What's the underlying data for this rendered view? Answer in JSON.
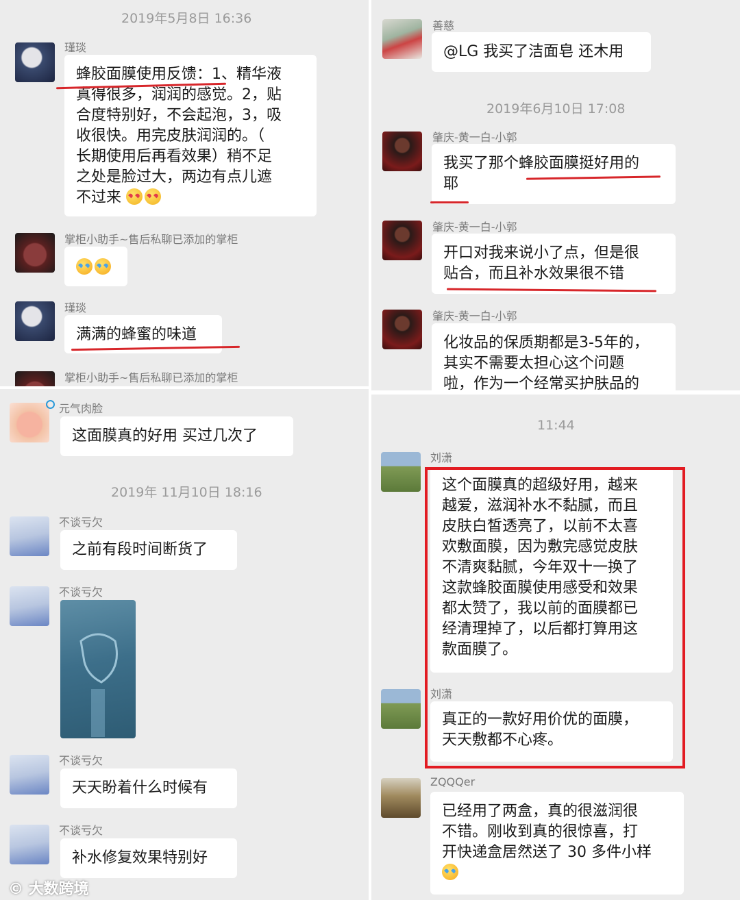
{
  "panel_top_left": {
    "timestamp": "2019年5月8日 16:36",
    "messages": [
      {
        "name": "瑾琰",
        "lines": [
          "蜂胶面膜使用反馈：1、精华液",
          "真得很多，润润的感觉。2，贴",
          "合度特别好，不会起泡，3，吸",
          "收很快。用完皮肤润润的。（",
          "长期使用后再看效果）稍不足",
          "之处是脸过大，两边有点儿遮",
          "不过来"
        ],
        "emoji": "heart-eyes-emoji"
      },
      {
        "name": "掌柜小助手~售后私聊已添加的掌柜",
        "emoji": "clapping-emoji"
      },
      {
        "name": "瑾琰",
        "lines": [
          "满满的蜂蜜的味道"
        ]
      },
      {
        "name": "掌柜小助手~售后私聊已添加的掌柜"
      }
    ]
  },
  "panel_top_right": {
    "messages": [
      {
        "name": "善慈",
        "lines": [
          "@LG 我买了洁面皂 还木用"
        ]
      },
      {
        "timestamp": "2019年6月10日 17:08"
      },
      {
        "name": "肇庆-黄一白-小郭",
        "lines": [
          "我买了那个蜂胶面膜挺好用的",
          "耶"
        ]
      },
      {
        "name": "肇庆-黄一白-小郭",
        "lines": [
          "开口对我来说小了点，但是很",
          "贴合，而且补水效果很不错"
        ]
      },
      {
        "name": "肇庆-黄一白-小郭",
        "lines": [
          "化妆品的保质期都是3-5年的，",
          "其实不需要太担心这个问题",
          "啦，作为一个经常买护肤品的"
        ]
      }
    ]
  },
  "panel_bottom_left": {
    "messages": [
      {
        "name": "元气肉脸",
        "lines": [
          "这面膜真的好用 买过几次了"
        ]
      },
      {
        "timestamp": "2019年 11月10日 18:16"
      },
      {
        "name": "不谈亏欠",
        "lines": [
          "之前有段时间断货了"
        ]
      },
      {
        "name": "不谈亏欠",
        "image": "product-photo"
      },
      {
        "name": "不谈亏欠",
        "lines": [
          "天天盼着什么时候有"
        ]
      },
      {
        "name": "不谈亏欠",
        "lines": [
          "补水修复效果特别好"
        ]
      }
    ]
  },
  "panel_bottom_right": {
    "timestamp": "11:44",
    "messages": [
      {
        "name": "刘潇",
        "lines": [
          "这个面膜真的超级好用，越来",
          "越爱，滋润补水不黏腻，而且",
          "皮肤白皙透亮了，以前不太喜",
          "欢敷面膜，因为敷完感觉皮肤",
          "不清爽黏腻，今年双十一换了",
          "这款蜂胶面膜使用感受和效果",
          "都太赞了，我以前的面膜都已",
          "经清理掉了，以后都打算用这",
          "款面膜了。"
        ]
      },
      {
        "name": "刘潇",
        "lines": [
          "真正的一款好用价优的面膜，",
          "天天敷都不心疼。"
        ]
      },
      {
        "name": "ZQQQer",
        "lines": [
          "已经用了两盒，真的很滋润很",
          "不错。刚收到真的很惊喜，打",
          "开快递盒居然送了 30 多件小样"
        ],
        "emoji": "laughing-tears-emoji"
      }
    ]
  },
  "watermark": "大数跨境",
  "colors": {
    "panel_bg": "#ececec",
    "bubble": "#ffffff",
    "underline": "#d7262a",
    "highlight_box": "#e21b22"
  }
}
